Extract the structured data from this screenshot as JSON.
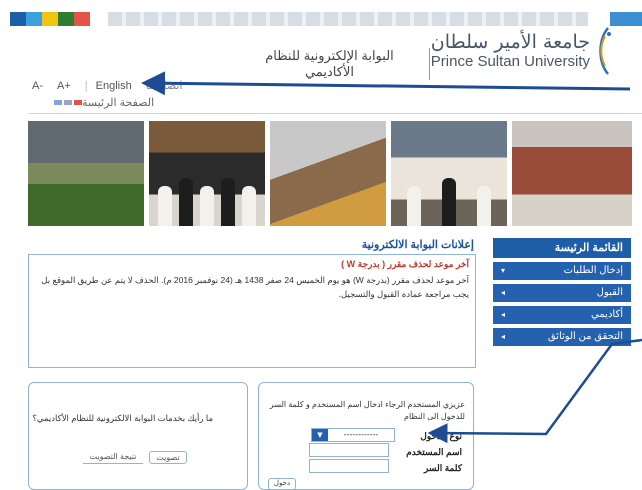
{
  "colors": {
    "accent": "#1e5da8",
    "arrow": "#1d4c94",
    "border": "#8fb4d7",
    "strip": [
      "#1e5da8",
      "#3aa0de",
      "#f1c40f",
      "#2e7d32",
      "#e2534a"
    ]
  },
  "header": {
    "logo_ar": "جامعة الأمير سلطان",
    "logo_en": "Prince Sultan University",
    "portal_title": "البوابة الإلكترونية للنظام الأكاديمي"
  },
  "topbar": {
    "font_smaller": "A-",
    "font_larger": "A+",
    "language": "English",
    "contact": "اتصل بنا"
  },
  "homebar": {
    "home_label": "الصفحة الرئيسة"
  },
  "news": {
    "title": "إعلانات البوابة الالكترونية",
    "subtitle": "آخر موعد لحذف مقرر ( بدرجة W )",
    "body": "آخر موعد لحذف مقرر (بدرجة W) هو يوم الخميس 24 صفر 1438 هـ (24 نوفمبر 2016 م). الحذف لا يتم عن طريق الموقع بل يجب مراجعة عمادة القبول والتسجيل."
  },
  "menu": {
    "title": "القائمة الرئيسة",
    "items": [
      {
        "label": "إدخال الطلبات",
        "icon": "chevron-down-icon"
      },
      {
        "label": "القبول",
        "icon": "chevron-left-icon"
      },
      {
        "label": "أكاديمي",
        "icon": "chevron-left-icon"
      },
      {
        "label": "التحقق من الوثائق",
        "icon": "chevron-left-icon"
      }
    ]
  },
  "login": {
    "message": "عزيزي المستخدم الرجاء ادخال اسم المستخدم و كلمة السر للدخول الى النظام",
    "type_label": "نوع الدخول",
    "type_value": "------------",
    "username_label": "اسم المستخدم",
    "password_label": "كلمة السر",
    "submit_label": "دخول"
  },
  "poll": {
    "question": "ما رأيك بخدمات البوابة الالكترونية للنظام الأكاديمي؟",
    "vote_label": "تصويت",
    "results_label": "نتيجة التصويت"
  }
}
